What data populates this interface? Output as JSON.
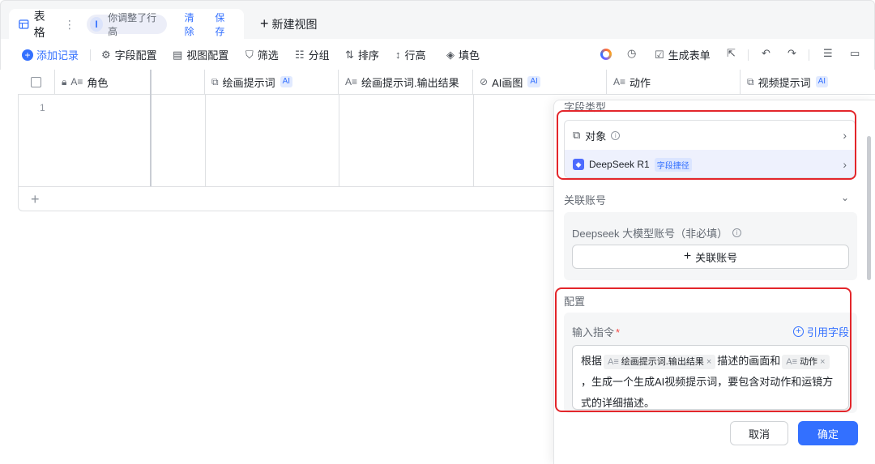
{
  "tabbar": {
    "table_name": "表格",
    "dots": "⋮",
    "status_text": "你调整了行高",
    "clear_label": "清除",
    "save_label": "保存",
    "new_view_label": "新建视图"
  },
  "toolbar": {
    "add_record": "添加记录",
    "field_config": "字段配置",
    "view_config": "视图配置",
    "filter": "筛选",
    "group": "分组",
    "sort": "排序",
    "row_height": "行高",
    "fill": "填色",
    "generate_form": "生成表单"
  },
  "grid": {
    "columns": [
      {
        "type_icon": "A≡",
        "label": "角色",
        "ai": ""
      },
      {
        "type_icon": "",
        "label": "",
        "ai": ""
      },
      {
        "type_icon": "⧉",
        "label": "绘画提示词",
        "ai": "AI"
      },
      {
        "type_icon": "A≡",
        "label": "绘画提示词.输出结果",
        "ai": ""
      },
      {
        "type_icon": "⊘",
        "label": "AI画图",
        "ai": "AI"
      },
      {
        "type_icon": "A≡",
        "label": "动作",
        "ai": ""
      },
      {
        "type_icon": "⧉",
        "label": "视频提示词",
        "ai": "AI"
      }
    ],
    "row_number": "1",
    "add_row": "+"
  },
  "panel": {
    "field_type_title": "字段类型",
    "type_object": "对象",
    "type_model": "DeepSeek R1",
    "type_model_badge": "字段捷径",
    "account_section": "关联账号",
    "account_label": "Deepseek 大模型账号（非必填）",
    "link_account_button": "关联账号",
    "config_section": "配置",
    "command_label": "输入指令",
    "required_mark": "*",
    "ref_field_label": "引用字段",
    "command_text": {
      "part1": "根据",
      "chip1": "绘画提示词.输出结果",
      "part2": "描述的画面和",
      "chip2": "动作",
      "part3": "，生成一个生成AI视频提示词，要包含对动作和运镜方式的详细描述。"
    },
    "cancel_label": "取消",
    "ok_label": "确定"
  },
  "colors": {
    "accent": "#3370ff",
    "annotation_red": "#e3262b"
  }
}
